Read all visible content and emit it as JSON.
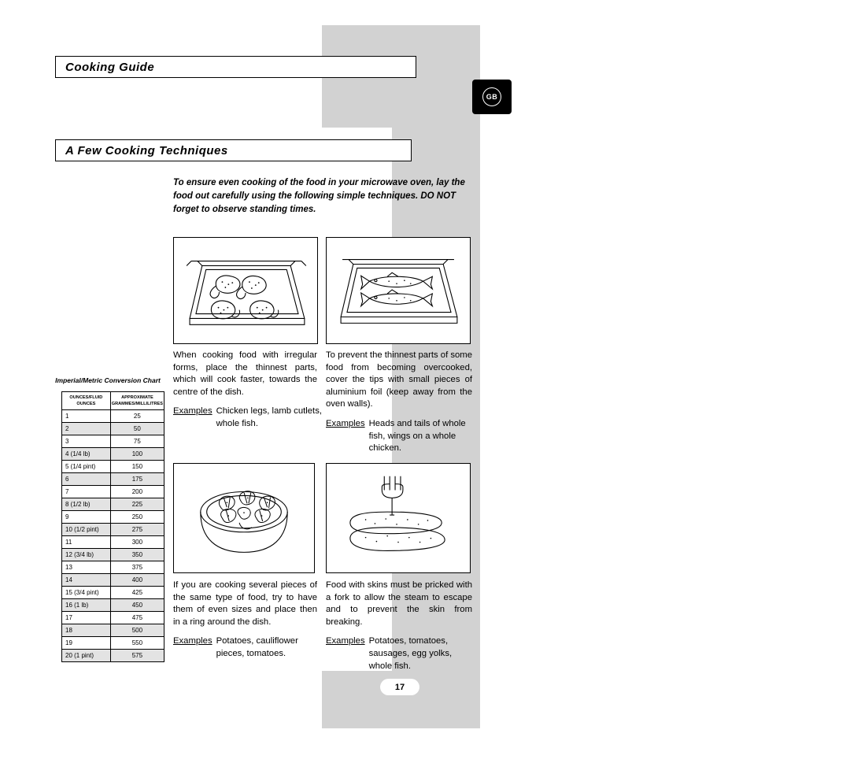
{
  "header": {
    "section_title": "Cooking Guide",
    "page_title": "A Few Cooking Techniques",
    "region_badge": "GB"
  },
  "intro": "To ensure even cooking of the food in your microwave oven, lay the food out carefully using the following simple techniques. DO NOT forget to observe standing times.",
  "panels": [
    {
      "illustration": "roasting-dish-with-chicken-legs",
      "body": "When cooking food with irregular forms, place the thinnest parts, which will cook faster, towards the centre of the dish.",
      "examples_label": "Examples",
      "examples": [
        "Chicken legs, lamb cutlets,",
        "whole fish."
      ]
    },
    {
      "illustration": "roasting-dish-with-whole-fish",
      "body": "To prevent the thinnest parts of some food from becoming overcooked, cover the tips with small pieces of aluminium foil (keep away from the oven walls).",
      "examples_label": "Examples",
      "examples": [
        "Heads and tails of whole",
        "fish, wings on a whole",
        "chicken."
      ]
    },
    {
      "illustration": "round-dish-with-vegetable-ring",
      "body": "If you are cooking several pieces of the same type of food, try to have them of even sizes and place then in a ring around the dish.",
      "examples_label": "Examples",
      "examples": [
        "Potatoes, cauliflower",
        "pieces, tomatoes."
      ]
    },
    {
      "illustration": "fork-pricking-sausages",
      "body": "Food with skins must be pricked with a fork to allow the steam to escape and to prevent the skin from breaking.",
      "examples_label": "Examples",
      "examples": [
        "Potatoes, tomatoes,",
        "sausages, egg yolks,",
        "whole fish."
      ]
    }
  ],
  "conversion_chart": {
    "caption": "Imperial/Metric Conversion Chart",
    "columns": [
      "OUNCES/FLUID OUNCES",
      "APPROXIMATE GRAMMES/MILLILITRES"
    ],
    "col0_line1": "OUNCES/FLUID",
    "col0_line2": "OUNCES",
    "col1_line1": "APPROXIMATE",
    "col1_line2": "GRAMMES/MILLILITRES",
    "rows": [
      [
        "1",
        "25"
      ],
      [
        "2",
        "50"
      ],
      [
        "3",
        "75"
      ],
      [
        "4   (1/4 lb)",
        "100"
      ],
      [
        "5   (1/4 pint)",
        "150"
      ],
      [
        "6",
        "175"
      ],
      [
        "7",
        "200"
      ],
      [
        "8   (1/2 lb)",
        "225"
      ],
      [
        "9",
        "250"
      ],
      [
        "10 (1/2 pint)",
        "275"
      ],
      [
        "11",
        "300"
      ],
      [
        "12 (3/4 lb)",
        "350"
      ],
      [
        "13",
        "375"
      ],
      [
        "14",
        "400"
      ],
      [
        "15 (3/4 pint)",
        "425"
      ],
      [
        "16 (1 lb)",
        "450"
      ],
      [
        "17",
        "475"
      ],
      [
        "18",
        "500"
      ],
      [
        "19",
        "550"
      ],
      [
        "20 (1 pint)",
        "575"
      ]
    ]
  },
  "page_number": "17"
}
